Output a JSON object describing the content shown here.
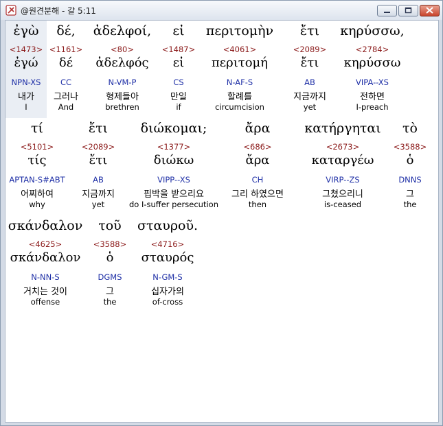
{
  "window": {
    "title": "@원견분해 - 갈 5:11"
  },
  "colors": {
    "strong": "#8b1a1a",
    "parse": "#1e2fa6",
    "highlight": "#eaeef4"
  },
  "rows": [
    {
      "words": [
        {
          "greek": "ἐγὼ",
          "strong": "<1473>",
          "lemma": "ἐγώ",
          "parse": "NPN-XS",
          "korean": "내가",
          "english": "I",
          "highlight": true
        },
        {
          "greek": "δέ,",
          "strong": "<1161>",
          "lemma": "δέ",
          "parse": "CC",
          "korean": "그러나",
          "english": "And"
        },
        {
          "greek": "ἀδελφοί,",
          "strong": "<80>",
          "lemma": "ἀδελφός",
          "parse": "N-VM-P",
          "korean": "형제들아",
          "english": "brethren"
        },
        {
          "greek": "εἰ",
          "strong": "<1487>",
          "lemma": "εἰ",
          "parse": "CS",
          "korean": "만일",
          "english": "if"
        },
        {
          "greek": "περιτομὴν",
          "strong": "<4061>",
          "lemma": "περιτομή",
          "parse": "N-AF-S",
          "korean": "할례를",
          "english": "circumcision"
        },
        {
          "greek": "ἔτι",
          "strong": "<2089>",
          "lemma": "ἔτι",
          "parse": "AB",
          "korean": "지금까지",
          "english": "yet"
        },
        {
          "greek": "κηρύσσω,",
          "strong": "<2784>",
          "lemma": "κηρύσσω",
          "parse": "VIPA--XS",
          "korean": "전하면",
          "english": "I-preach"
        }
      ]
    },
    {
      "words": [
        {
          "greek": "τί",
          "strong": "<5101>",
          "lemma": "τίς",
          "parse": "APTAN-S#ABT",
          "korean": "어찌하여",
          "english": "why"
        },
        {
          "greek": "ἔτι",
          "strong": "<2089>",
          "lemma": "ἔτι",
          "parse": "AB",
          "korean": "지금까지",
          "english": "yet"
        },
        {
          "greek": "διώκομαι;",
          "strong": "<1377>",
          "lemma": "διώκω",
          "parse": "VIPP--XS",
          "korean": "핍박을 받으리요",
          "english": "do I-suffer persecution"
        },
        {
          "greek": "ἄρα",
          "strong": "<686>",
          "lemma": "ἄρα",
          "parse": "CH",
          "korean": "그리 하였으면",
          "english": "then"
        },
        {
          "greek": "κατήργηται",
          "strong": "<2673>",
          "lemma": "καταργέω",
          "parse": "VIRP--ZS",
          "korean": "그쳤으리니",
          "english": "is-ceased"
        },
        {
          "greek": "τὸ",
          "strong": "<3588>",
          "lemma": "ὁ",
          "parse": "DNNS",
          "korean": "그",
          "english": "the"
        }
      ]
    },
    {
      "words": [
        {
          "greek": "σκάνδαλον",
          "strong": "<4625>",
          "lemma": "σκάνδαλον",
          "parse": "N-NN-S",
          "korean": "거치는 것이",
          "english": "offense"
        },
        {
          "greek": "τοῦ",
          "strong": "<3588>",
          "lemma": "ὁ",
          "parse": "DGMS",
          "korean": "그",
          "english": "the"
        },
        {
          "greek": "σταυροῦ.",
          "strong": "<4716>",
          "lemma": "σταυρός",
          "parse": "N-GM-S",
          "korean": "십자가의",
          "english": "of-cross"
        }
      ]
    }
  ]
}
